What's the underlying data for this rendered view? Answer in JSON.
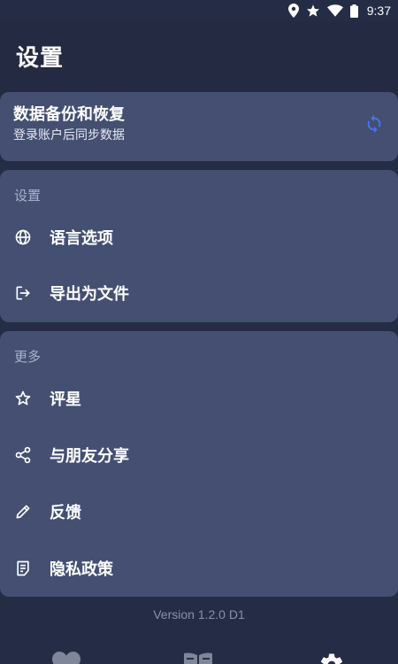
{
  "status_bar": {
    "time": "9:37",
    "icons": [
      "location-icon",
      "star-icon",
      "wifi-icon",
      "battery-icon"
    ]
  },
  "header": {
    "title": "设置"
  },
  "backup": {
    "title": "数据备份和恢复",
    "subtitle": "登录账户后同步数据",
    "icon": "sync-icon",
    "accent": "#4c74f0"
  },
  "settings_section": {
    "label": "设置",
    "items": [
      {
        "label": "语言选项",
        "icon": "globe-icon"
      },
      {
        "label": "导出为文件",
        "icon": "export-icon"
      }
    ]
  },
  "more_section": {
    "label": "更多",
    "items": [
      {
        "label": "评星",
        "icon": "star-outline-icon"
      },
      {
        "label": "与朋友分享",
        "icon": "share-icon"
      },
      {
        "label": "反馈",
        "icon": "pencil-icon"
      },
      {
        "label": "隐私政策",
        "icon": "document-icon"
      }
    ]
  },
  "footer": {
    "version": "Version 1.2.0 D1"
  },
  "bottom_nav": {
    "items": [
      {
        "icon": "heart-icon"
      },
      {
        "icon": "book-icon"
      },
      {
        "icon": "gear-icon"
      }
    ]
  },
  "colors": {
    "background": "#252c45",
    "card": "#444f72",
    "section_label": "#aab2cc",
    "version_text": "#8a91a8"
  }
}
